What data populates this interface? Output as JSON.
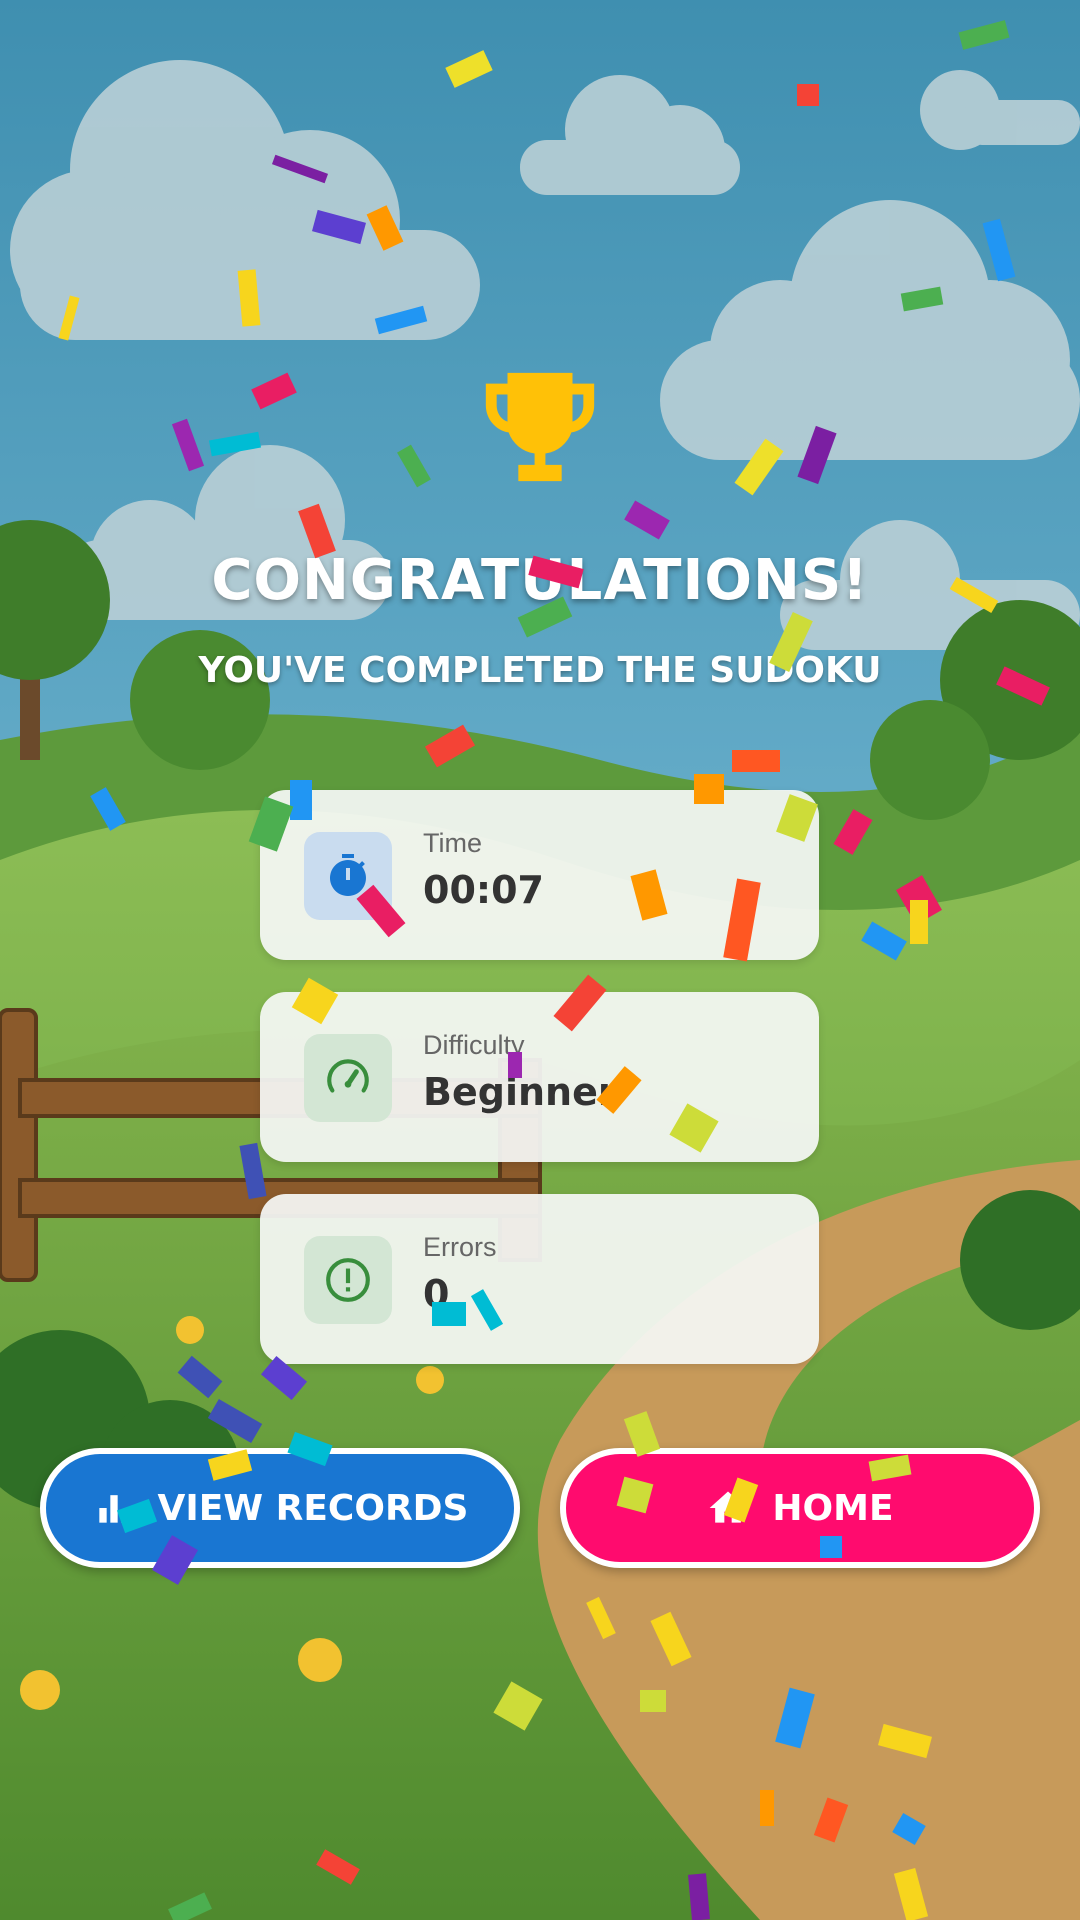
{
  "header": {
    "title": "CONGRATULATIONS!",
    "subtitle": "YOU'VE COMPLETED THE SUDOKU"
  },
  "icons": {
    "trophy": "trophy-icon",
    "time": "stopwatch-icon",
    "difficulty": "speedometer-icon",
    "errors": "alert-circle-icon",
    "records": "bar-chart-icon",
    "home": "home-icon"
  },
  "stats": {
    "time": {
      "label": "Time",
      "value": "00:07"
    },
    "difficulty": {
      "label": "Difficulty",
      "value": "Beginner"
    },
    "errors": {
      "label": "Errors",
      "value": "0"
    }
  },
  "actions": {
    "records_label": "VIEW RECORDS",
    "home_label": "HOME"
  },
  "colors": {
    "trophy": "#FFC107",
    "time_icon": "#1976D2",
    "time_icon_bg": "#C9DCEF",
    "difficulty_icon": "#388E3C",
    "difficulty_icon_bg": "#D3E6D4",
    "errors_icon": "#388E3C",
    "errors_icon_bg": "#D3E6D4",
    "records_button": "#1976D2",
    "home_button": "#FF0B6E"
  }
}
